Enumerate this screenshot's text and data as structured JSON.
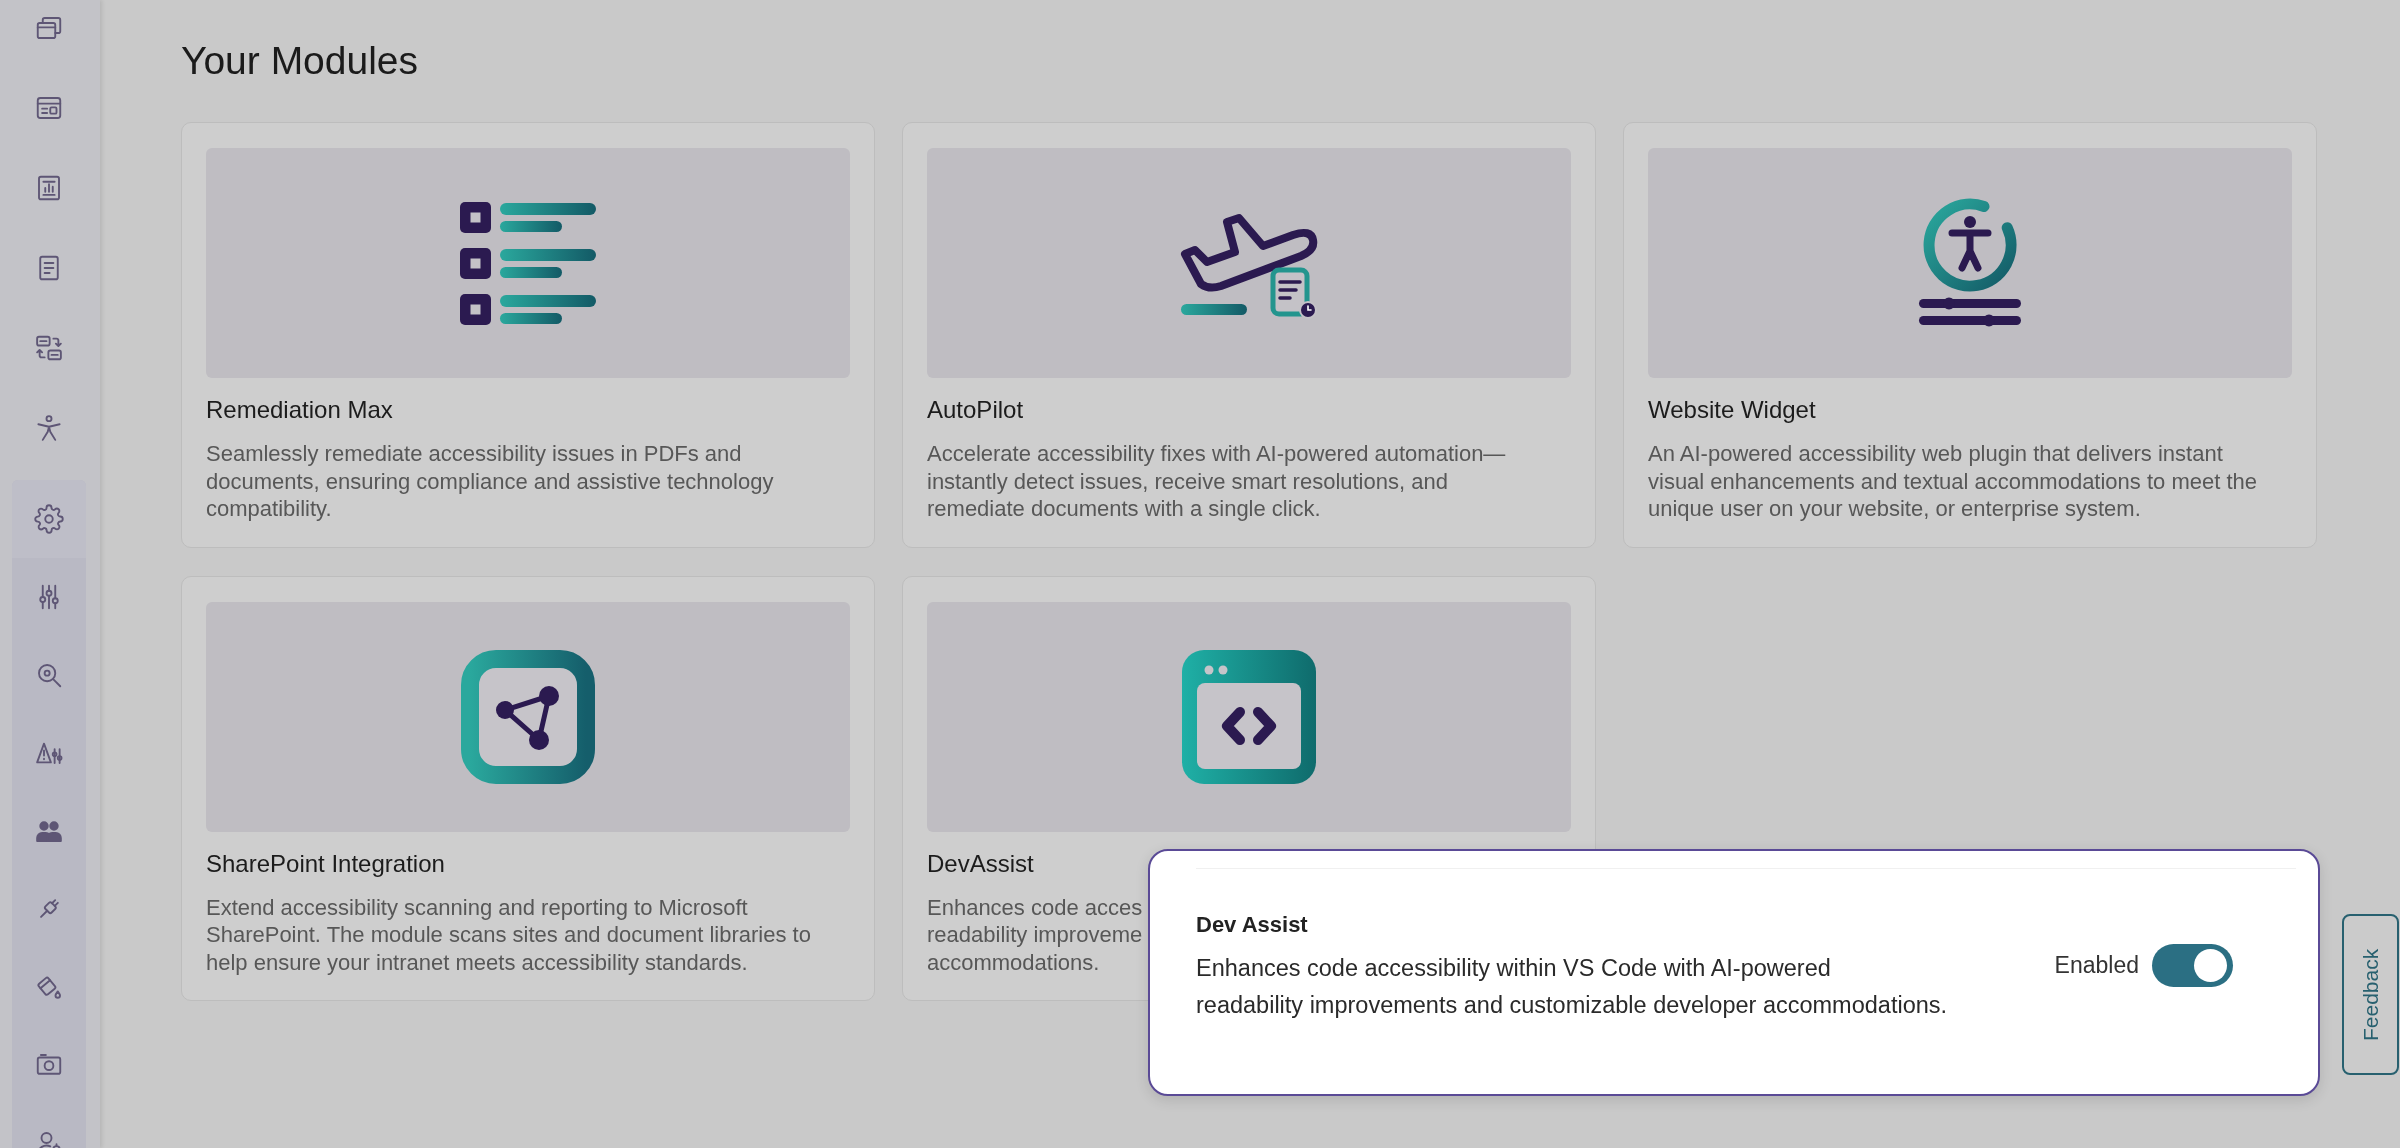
{
  "sidebar": {
    "settings_group": {
      "expanded": true
    }
  },
  "page": {
    "title": "Your Modules"
  },
  "modules": [
    {
      "title": "Remediation Max",
      "description_lines": [
        "Seamlessly remediate accessibility issues in PDFs and",
        "documents, ensuring compliance and assistive technology",
        "compatibility."
      ]
    },
    {
      "title": "AutoPilot",
      "description_lines": [
        "Accelerate accessibility fixes with AI-powered automation—",
        "instantly detect issues, receive smart resolutions, and",
        "remediate documents with a single click."
      ]
    },
    {
      "title": "Website Widget",
      "description_lines": [
        "An AI-powered accessibility web plugin that delivers instant",
        "visual enhancements and textual accommodations to meet the",
        "unique user on your website, or enterprise system."
      ]
    },
    {
      "title": "SharePoint Integration",
      "description_lines": [
        "Extend accessibility scanning and reporting to Microsoft",
        "SharePoint. The module scans sites and document libraries to",
        "help ensure your intranet meets accessibility standards."
      ]
    },
    {
      "title": "DevAssist",
      "description_lines": [
        "Enhances code acces",
        "readability improveme",
        "accommodations."
      ]
    }
  ],
  "dev_assist_popup": {
    "title": "Dev Assist",
    "description_lines": [
      "Enhances code accessibility within VS Code with AI-powered",
      "readability improvements and customizable developer accommodations."
    ],
    "toggle": {
      "label": "Enabled",
      "on": true
    }
  },
  "feedback_tab": {
    "label": "Feedback"
  }
}
